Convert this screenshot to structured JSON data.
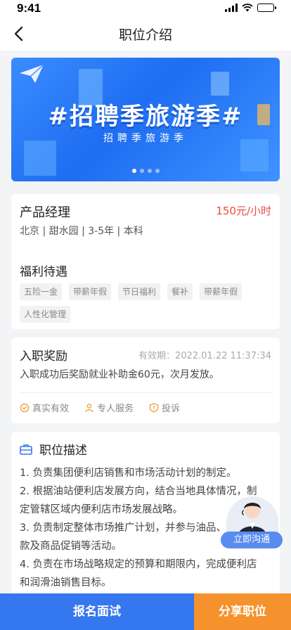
{
  "status_bar": {
    "time": "9:41"
  },
  "nav": {
    "title": "职位介绍"
  },
  "banner": {
    "title": "#招聘季旅游季#",
    "subtitle": "招聘季旅游季",
    "dots_total": 4,
    "dots_active": 1
  },
  "job": {
    "title": "产品经理",
    "salary": "150元/小时",
    "meta": "北京 | 甜水园 | 3-5年 | 本科",
    "welfare_title": "福利待遇",
    "welfare_tags": [
      "五险一金",
      "带薪年假",
      "节日福利",
      "餐补",
      "带薪年假",
      "人性化管理"
    ]
  },
  "reward": {
    "title": "入职奖励",
    "valid": "有效期：2022.01.22 11:37:34",
    "desc": "入职成功后奖励就业补助金60元，次月发放。",
    "assurances": [
      "真实有效",
      "专人服务",
      "投诉"
    ]
  },
  "description": {
    "title": "职位描述",
    "lines": [
      "1. 负责集团便利店销售和市场活动计划的制定。",
      "2. 根据油站便利店发展方向，结合当地具体情况，制",
      "定管辖区域内便利店市场发展战略。",
      "3. 负责制定整体市场推广计划，并参与油品、",
      "款及商品促销等活动。",
      "4. 负责在市场战略规定的预算和期限内，完成便利店",
      "和润滑油销售目标。"
    ]
  },
  "contact": {
    "label": "立即沟通"
  },
  "actions": {
    "apply": "报名面试",
    "share": "分享职位"
  },
  "colors": {
    "primary": "#3477ee",
    "accent": "#f5922d",
    "salary": "#e84a3c",
    "assure_icon": "#f0a040"
  }
}
